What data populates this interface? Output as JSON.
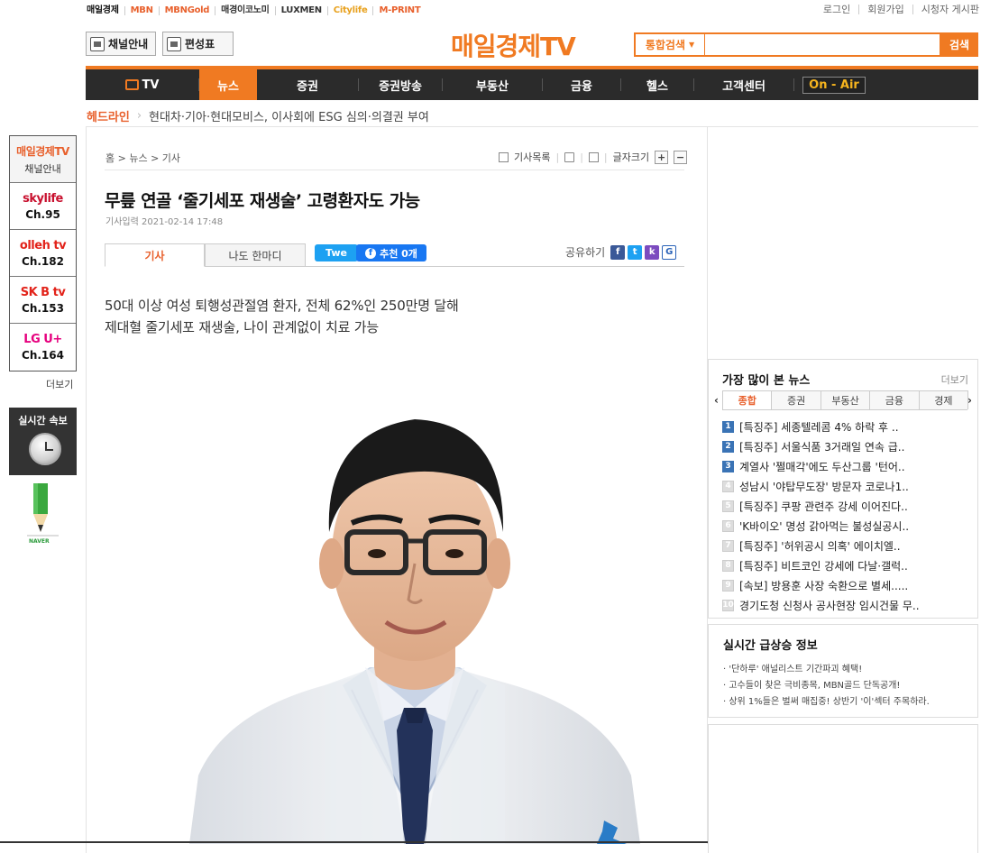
{
  "family_sites": [
    "매일경제",
    "MBN",
    "MBNGold",
    "매경이코노미",
    "LUXMEN",
    "Citylife",
    "M-PRINT"
  ],
  "top_util": [
    "로그인",
    "회원가입",
    "시청자 게시판"
  ],
  "header": {
    "channel_btn": "채널안내",
    "schedule_btn": "편성표",
    "logo": "매일경제TV",
    "search_select": "통합검색",
    "search_placeholder": "",
    "search_btn": "검색"
  },
  "nav": {
    "tv": "TV",
    "news": "뉴스",
    "stock": "증권",
    "stock_broadcast": "증권방송",
    "realestate": "부동산",
    "finance": "금융",
    "health": "헬스",
    "support": "고객센터",
    "onair": "On - Air"
  },
  "headline": {
    "label": "헤드라인",
    "text": "현대차·기아·현대모비스, 이사회에 ESG 심의·의결권 부여"
  },
  "channels": {
    "first": {
      "brand": "매일경제TV",
      "sub": "채널안내"
    },
    "items": [
      {
        "brand": "skylife",
        "ch": "Ch.95",
        "color": "#c8102e"
      },
      {
        "brand": "olleh tv",
        "ch": "Ch.182",
        "color": "#e2231a"
      },
      {
        "brand": "SK B tv",
        "ch": "Ch.153",
        "color": "#e2231a"
      },
      {
        "brand": "LG U+",
        "ch": "Ch.164",
        "color": "#e6007e"
      }
    ],
    "more": "더보기",
    "realtime": "실시간 속보",
    "naver": "NAVER"
  },
  "article": {
    "crumb": "홈 > 뉴스 > 기사",
    "tools": {
      "list": "기사목록",
      "fontsize": "글자크기",
      "plus": "+",
      "minus": "−"
    },
    "title": "무릎 연골 ‘줄기세포 재생술’ 고령환자도 가능",
    "date": "기사입력 2021-02-14 17:48",
    "tabs": {
      "article": "기사",
      "comment": "나도 한마디"
    },
    "tweet": "Twe",
    "fb": "추천 0개",
    "share": "공유하기",
    "sub1": "50대 이상 여성 퇴행성관절염 환자, 전체 62%인 250만명 달해",
    "sub2": "제대혈 줄기세포 재생술, 나이 관계없이 치료 가능"
  },
  "popular": {
    "title": "가장 많이 본 뉴스",
    "more": "더보기",
    "tabs": [
      "종합",
      "증권",
      "부동산",
      "금융",
      "경제"
    ],
    "items": [
      "[특징주] 세종텔레콤 4% 하락 후 ..",
      "[특징주] 서울식품 3거래일 연속 급..",
      "계열사 '쩔매각'에도 두산그룹 '턴어..",
      "성남시 '야탑무도장' 방문자 코로나1..",
      "[특징주] 쿠팡 관련주 강세 이어진다..",
      "'K바이오' 명성 갉아먹는 불성실공시..",
      "[특징주] '허위공시 의혹' 에이치엘..",
      "[특징주] 비트코인 강세에 다날·갤럭..",
      "[속보] 방용훈 사장 숙환으로 별세.....",
      "경기도청 신청사 공사현장 임시건물 무.."
    ]
  },
  "rising": {
    "title": "실시간 급상승 정보",
    "items": [
      "· '단하루' 애널리스트 기간파괴 혜택!",
      "· 고수들이 찾은 극비종목, MBN골드 단독공개!",
      "· 상위 1%들은 벌써 매집중! 상반기 '이'섹터 주목하라."
    ]
  }
}
